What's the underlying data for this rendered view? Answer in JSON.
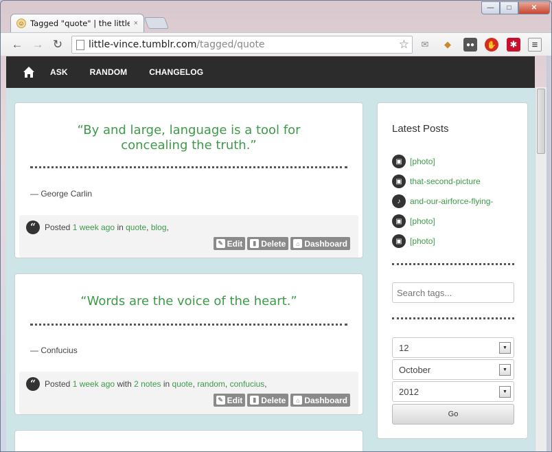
{
  "browser": {
    "tab_title": "Tagged \"quote\" | the little v",
    "tab_close": "×",
    "url_host": "little-vince.tumblr.com",
    "url_path": "/tagged/quote",
    "window_buttons": {
      "minimize": "—",
      "maximize": "□",
      "close": "✕"
    }
  },
  "nav": {
    "items": [
      "ASK",
      "RANDOM",
      "CHANGELOG"
    ]
  },
  "posts": [
    {
      "quote": "“By and large, language is a tool for concealing the truth.”",
      "source": "— George Carlin",
      "posted": "Posted",
      "time": "1 week ago",
      "notes_pre": "",
      "notes": "",
      "in": "in",
      "tags": [
        "quote",
        "blog"
      ],
      "edit": "Edit",
      "delete": "Delete",
      "dashboard": "Dashboard"
    },
    {
      "quote": "“Words are the voice of the heart.”",
      "source": "— Confucius",
      "posted": "Posted",
      "time": "1 week ago",
      "notes_pre": "with",
      "notes": "2 notes",
      "in": "in",
      "tags": [
        "quote",
        "random",
        "confucius"
      ],
      "edit": "Edit",
      "delete": "Delete",
      "dashboard": "Dashboard"
    }
  ],
  "sidebar": {
    "title": "Latest Posts",
    "latest": [
      {
        "label": "[photo]",
        "icon": "photo-icon"
      },
      {
        "label": "that-second-picture",
        "icon": "photo-icon"
      },
      {
        "label": "and-our-airforce-flying-",
        "icon": "audio-icon"
      },
      {
        "label": "[photo]",
        "icon": "photo-icon"
      },
      {
        "label": "[photo]",
        "icon": "photo-icon"
      }
    ],
    "search_placeholder": "Search tags...",
    "day": "12",
    "month": "October",
    "year": "2012",
    "go": "Go"
  },
  "colors": {
    "accent": "#3d9a49",
    "nav_bg": "#2c2c2c",
    "page_bg": "#cde5e6"
  }
}
